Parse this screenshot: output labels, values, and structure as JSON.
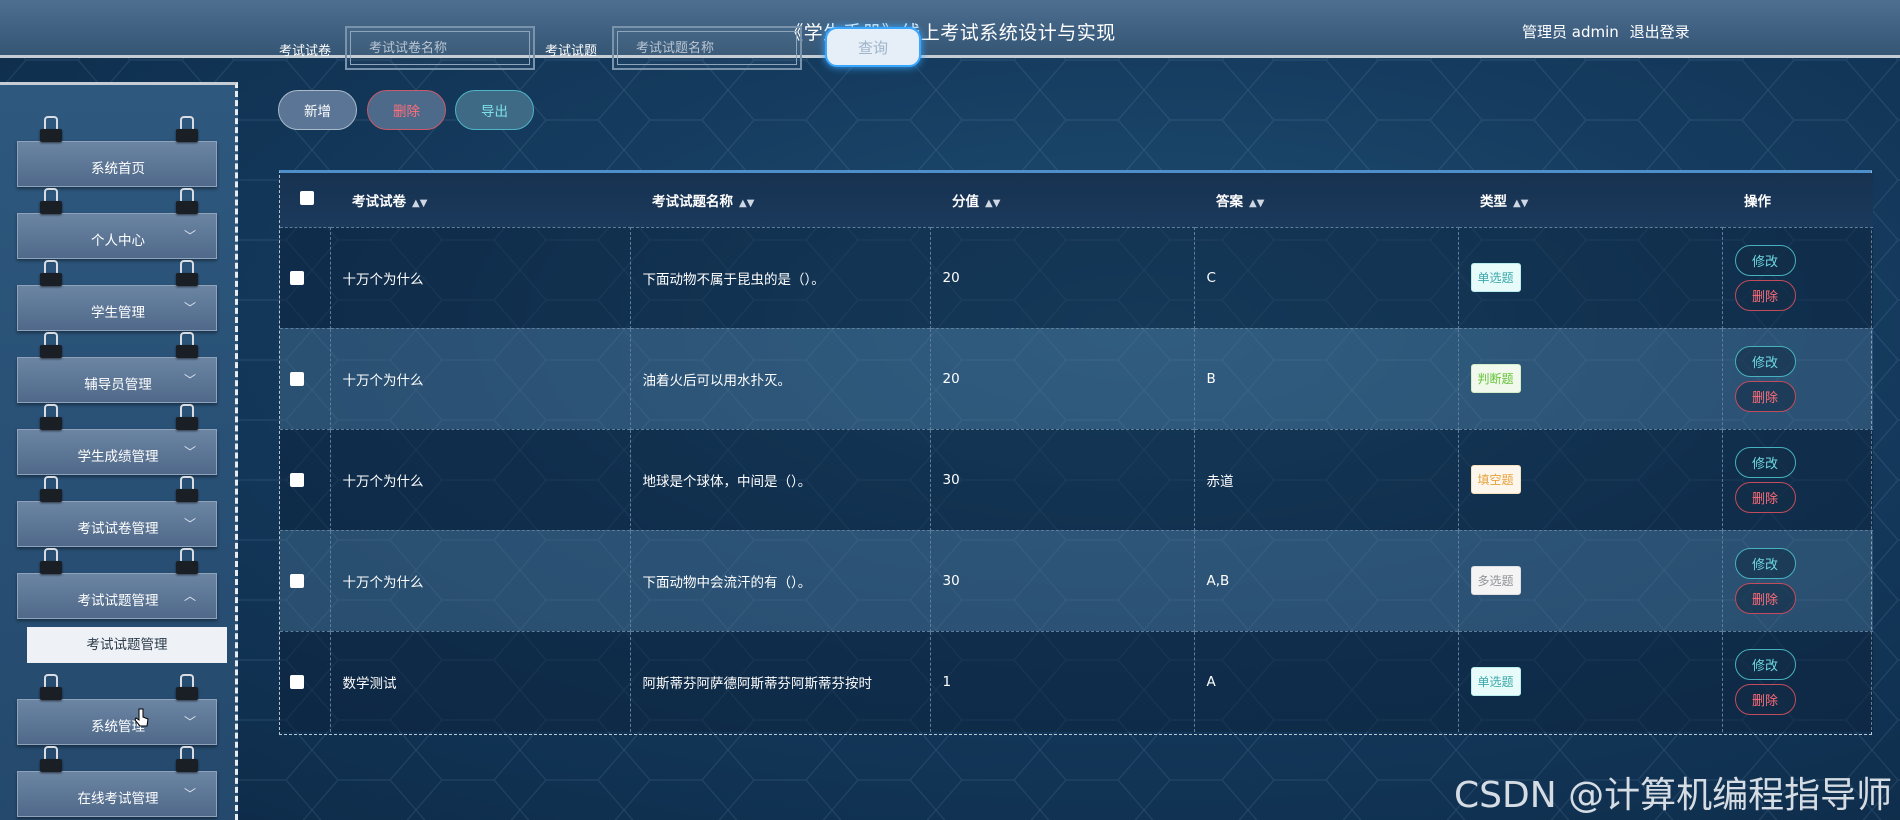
{
  "header": {
    "app_title": "《学生手册》线上考试系统设计与实现",
    "admin_label": "管理员 admin",
    "logout_label": "退出登录"
  },
  "search": {
    "paper_label": "考试试卷",
    "paper_placeholder": "考试试卷名称",
    "question_label": "考试试题",
    "question_placeholder": "考试试题名称",
    "query_button": "查询"
  },
  "sidebar": {
    "items": [
      {
        "label": "系统首页",
        "has_chevron": false
      },
      {
        "label": "个人中心",
        "has_chevron": true
      },
      {
        "label": "学生管理",
        "has_chevron": true
      },
      {
        "label": "辅导员管理",
        "has_chevron": true
      },
      {
        "label": "学生成绩管理",
        "has_chevron": true
      },
      {
        "label": "考试试卷管理",
        "has_chevron": true
      },
      {
        "label": "考试试题管理",
        "has_chevron": true,
        "expanded": true
      },
      {
        "label": "系统管理",
        "has_chevron": true
      },
      {
        "label": "在线考试管理",
        "has_chevron": true
      }
    ],
    "submenu_active": "考试试题管理"
  },
  "actions": {
    "add": "新增",
    "delete": "删除",
    "export": "导出"
  },
  "table": {
    "columns": [
      "考试试卷",
      "考试试题名称",
      "分值",
      "答案",
      "类型",
      "操作"
    ],
    "rows": [
      {
        "paper": "十万个为什么",
        "question": "下面动物不属于昆虫的是（）。",
        "score": "20",
        "answer": "C",
        "type": "单选题",
        "type_style": "single"
      },
      {
        "paper": "十万个为什么",
        "question": "油着火后可以用水扑灭。",
        "score": "20",
        "answer": "B",
        "type": "判断题",
        "type_style": "judge"
      },
      {
        "paper": "十万个为什么",
        "question": "地球是个球体，中间是（）。",
        "score": "30",
        "answer": "赤道",
        "type": "填空题",
        "type_style": "fill"
      },
      {
        "paper": "十万个为什么",
        "question": "下面动物中会流汗的有（）。",
        "score": "30",
        "answer": "A,B",
        "type": "多选题",
        "type_style": "multi"
      },
      {
        "paper": "数学测试",
        "question": "阿斯蒂芬阿萨德阿斯蒂芬阿斯蒂芬按时",
        "score": "1",
        "answer": "A",
        "type": "单选题",
        "type_style": "single"
      }
    ],
    "edit_label": "修改",
    "delete_label": "删除"
  },
  "watermark": "CSDN @计算机编程指导师"
}
